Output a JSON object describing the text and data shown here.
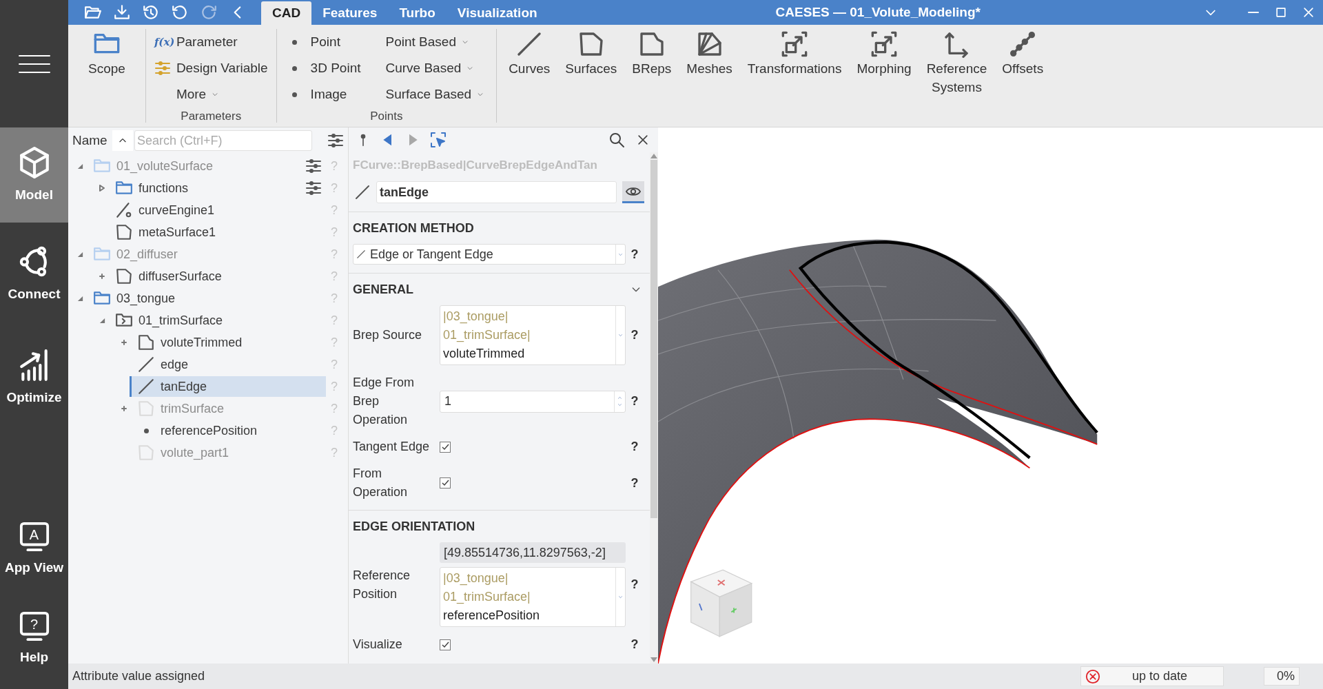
{
  "title_bar": {
    "quick_access": [
      {
        "disabled": false
      },
      {
        "disabled": false
      },
      {
        "disabled": false
      },
      {
        "disabled": false
      },
      {
        "disabled": true
      },
      {
        "disabled": false
      }
    ],
    "tabs": [
      {
        "label": "CAD",
        "selected": true
      },
      {
        "label": "Features",
        "selected": false
      },
      {
        "label": "Turbo",
        "selected": false
      },
      {
        "label": "Visualization",
        "selected": false
      }
    ],
    "title": "CAESES — 01_Volute_Modeling*"
  },
  "nav": {
    "top": [
      {
        "label": "Model",
        "selected": true
      },
      {
        "label": "Connect",
        "selected": false
      },
      {
        "label": "Optimize",
        "selected": false
      }
    ],
    "bottom": [
      {
        "label": "App View",
        "glyph": "A",
        "selected": false
      },
      {
        "label": "Help",
        "glyph": "?",
        "selected": false
      }
    ]
  },
  "ribbon": {
    "groups": [
      {
        "kind": "large",
        "buttons": [
          {
            "label": "Scope"
          }
        ]
      },
      {
        "kind": "list",
        "label": "Parameters",
        "buttons": [
          {
            "label": "Parameter",
            "kind": "formula",
            "glyph": "f(x)",
            "dropdown": false
          },
          {
            "label": "Design Variable",
            "kind": "variable",
            "dropdown": false
          },
          {
            "label": "More",
            "kind": "plain",
            "dropdown": true
          }
        ]
      },
      {
        "kind": "columns",
        "label": "Points",
        "buttons": [
          {
            "label": "Point",
            "kind": "bullet",
            "dropdown": false
          },
          {
            "label": "3D Point",
            "kind": "bullet",
            "dropdown": false
          },
          {
            "label": "Image",
            "kind": "bullet",
            "dropdown": false
          },
          {
            "label": "Point Based",
            "kind": "plain",
            "dropdown": true
          },
          {
            "label": "Curve Based",
            "kind": "plain",
            "dropdown": true
          },
          {
            "label": "Surface Based",
            "kind": "plain",
            "dropdown": true
          }
        ]
      },
      {
        "kind": "large",
        "buttons": [
          {
            "label": "Curves"
          },
          {
            "label": "Surfaces"
          },
          {
            "label": "BReps"
          },
          {
            "label": "Meshes"
          },
          {
            "label": "Transformations"
          },
          {
            "label": "Morphing"
          },
          {
            "label": "Reference Systems"
          },
          {
            "label": "Offsets"
          }
        ]
      }
    ]
  },
  "tree": {
    "column": "Name",
    "search_placeholder": "Search (Ctrl+F)",
    "items": [
      {
        "label": "01_voluteSurface",
        "kind": "folder",
        "expanded": true,
        "dimmed": true,
        "selected": false,
        "settings": true,
        "help": "?",
        "children": [
          {
            "label": "functions",
            "kind": "folder",
            "expanded": false,
            "dimmed": false,
            "selected": false,
            "settings": true,
            "help": "?"
          },
          {
            "label": "curveEngine1",
            "kind": "engine",
            "dimmed": false,
            "selected": false,
            "settings": false,
            "help": "?"
          },
          {
            "label": "metaSurface1",
            "kind": "surface",
            "dimmed": false,
            "selected": false,
            "settings": false,
            "help": "?"
          }
        ]
      },
      {
        "label": "02_diffuser",
        "kind": "folder",
        "expanded": true,
        "dimmed": true,
        "selected": false,
        "settings": false,
        "help": "?",
        "children": [
          {
            "label": "diffuserSurface",
            "kind": "surface",
            "expanded": false,
            "dimmed": false,
            "selected": false,
            "settings": false,
            "help": "?"
          }
        ]
      },
      {
        "label": "03_tongue",
        "kind": "folder",
        "expanded": true,
        "dimmed": false,
        "selected": false,
        "settings": false,
        "help": "?",
        "children": [
          {
            "label": "01_trimSurface",
            "kind": "scope",
            "expanded": true,
            "dimmed": false,
            "selected": false,
            "settings": false,
            "help": "?",
            "children": [
              {
                "label": "voluteTrimmed",
                "kind": "brep",
                "expanded": false,
                "dimmed": false,
                "selected": false,
                "settings": false,
                "help": "?"
              },
              {
                "label": "edge",
                "kind": "curve",
                "dimmed": false,
                "selected": false,
                "settings": false,
                "help": "?"
              },
              {
                "label": "tanEdge",
                "kind": "curve",
                "dimmed": false,
                "selected": true,
                "settings": false,
                "help": "?"
              },
              {
                "label": "trimSurface",
                "kind": "surface",
                "expanded": false,
                "dimmed": true,
                "selected": false,
                "settings": false,
                "help": "?"
              },
              {
                "label": "referencePosition",
                "kind": "point",
                "dimmed": false,
                "selected": false,
                "settings": false,
                "help": "?"
              },
              {
                "label": "volute_part1",
                "kind": "surface",
                "dimmed": true,
                "selected": false,
                "settings": false,
                "help": "?"
              }
            ]
          }
        ]
      }
    ]
  },
  "properties": {
    "navigation": [
      {
        "disabled": false
      },
      {
        "disabled": true
      }
    ],
    "type_path": "FCurve::BrepBased|CurveBrepEdgeAndTan",
    "name": "tanEdge",
    "visible": true,
    "sections": [
      {
        "title": "CREATION METHOD",
        "rows": [
          {
            "kind": "dropdown",
            "value": "Edge or Tangent Edge",
            "help": "?"
          }
        ]
      },
      {
        "title": "GENERAL",
        "expanded": true,
        "rows": [
          {
            "kind": "reference",
            "label": "Brep Source",
            "path": [
              "|03_tongue|",
              "01_trimSurface|"
            ],
            "target": "voluteTrimmed",
            "help": "?"
          },
          {
            "kind": "spinbox",
            "label": "Edge From Brep Operation",
            "value": "1",
            "help": "?"
          },
          {
            "kind": "checkbox",
            "label": "Tangent Edge",
            "checked": true,
            "help": "?"
          },
          {
            "kind": "checkbox",
            "label": "From Operation",
            "checked": true,
            "help": "?"
          }
        ]
      },
      {
        "title": "EDGE ORIENTATION",
        "rows": [
          {
            "kind": "reference",
            "label": "Reference Position",
            "readout": "[49.85514736,11.8297563,-2]",
            "path": [
              "|03_tongue|",
              "01_trimSurface|"
            ],
            "target": "referencePosition",
            "help": "?"
          },
          {
            "kind": "checkbox",
            "label": "Visualize",
            "checked": true,
            "help": "?"
          }
        ]
      }
    ]
  },
  "status_bar": {
    "message": "Attribute value assigned",
    "state": "up to date",
    "progress": "0%"
  }
}
